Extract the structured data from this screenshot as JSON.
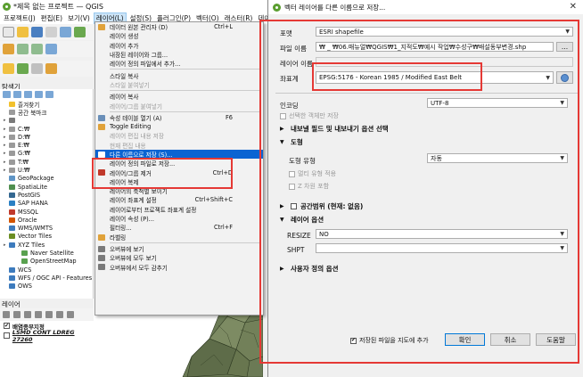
{
  "qgis": {
    "title": "*제목 없는 프로젝트 — QGIS",
    "menus": [
      "프로젝트(J)",
      "편집(E)",
      "보기(V)",
      "레이어(L)",
      "설정(S)",
      "플러그인(P)",
      "벡터(O)",
      "래스터(R)",
      "데이"
    ],
    "browser_title": "탐색기",
    "browser_items": [
      {
        "label": "즐겨찾기",
        "icon": "star-icon",
        "color": "#f2c12e"
      },
      {
        "label": "공간 북마크",
        "icon": "bookmark-icon",
        "color": "#9b9b9b"
      },
      {
        "label": "",
        "icon": "home-icon",
        "color": "#7a7a7a"
      },
      {
        "label": "C:₩",
        "icon": "drive-icon",
        "color": "#9a9a9a"
      },
      {
        "label": "D:₩",
        "icon": "drive-icon",
        "color": "#9a9a9a"
      },
      {
        "label": "E:₩",
        "icon": "drive-icon",
        "color": "#9a9a9a"
      },
      {
        "label": "G:₩",
        "icon": "drive-icon",
        "color": "#9a9a9a"
      },
      {
        "label": "T:₩",
        "icon": "drive-icon",
        "color": "#9a9a9a"
      },
      {
        "label": "U:₩",
        "icon": "drive-icon",
        "color": "#9a9a9a"
      },
      {
        "label": "GeoPackage",
        "icon": "geopackage-icon",
        "color": "#5f95c6"
      },
      {
        "label": "SpatiaLite",
        "icon": "spatialite-icon",
        "color": "#4f8f4f"
      },
      {
        "label": "PostGIS",
        "icon": "postgis-icon",
        "color": "#336791"
      },
      {
        "label": "SAP HANA",
        "icon": "sap-hana-icon",
        "color": "#2a80c4"
      },
      {
        "label": "MSSQL",
        "icon": "mssql-icon",
        "color": "#c0392b"
      },
      {
        "label": "Oracle",
        "icon": "oracle-icon",
        "color": "#d35400"
      },
      {
        "label": "WMS/WMTS",
        "icon": "wms-icon",
        "color": "#3d7bbd"
      },
      {
        "label": "Vector Tiles",
        "icon": "vector-tiles-icon",
        "color": "#6b8e23"
      },
      {
        "label": "XYZ Tiles",
        "icon": "xyz-tiles-icon",
        "color": "#3d7bbd"
      },
      {
        "label": "Naver Satellite",
        "icon": "tile-layer-icon",
        "color": "#59a14f"
      },
      {
        "label": "OpenStreetMap",
        "icon": "tile-layer-icon",
        "color": "#59a14f"
      },
      {
        "label": "WCS",
        "icon": "wcs-icon",
        "color": "#3d7bbd"
      },
      {
        "label": "WFS / OGC API - Features",
        "icon": "wfs-icon",
        "color": "#3d7bbd"
      },
      {
        "label": "OWS",
        "icon": "ows-icon",
        "color": "#3d7bbd"
      }
    ],
    "layers_title": "레이어",
    "layers": [
      {
        "label": "배염종부지정",
        "checked": true
      },
      {
        "label": "LSMD CONT LDREG 27260",
        "checked": false
      }
    ]
  },
  "context_menu": [
    {
      "label": "데이터 원본 관리자 (D)",
      "shortcut": "Ctrl+L",
      "icon": "data-source-icon",
      "color": "#e0a23a"
    },
    {
      "label": "레이어 생성",
      "icon": "",
      "color": ""
    },
    {
      "label": "레이어 추가",
      "icon": "",
      "color": ""
    },
    {
      "label": "내장된 레이어와 그룹...",
      "icon": "",
      "color": ""
    },
    {
      "label": "레이어 정의 파일에서 추가...",
      "icon": "",
      "color": ""
    },
    {
      "sep": true
    },
    {
      "label": "스타일 복사",
      "icon": "",
      "color": ""
    },
    {
      "label": "스타일 붙여넣기",
      "disabled": true,
      "icon": "",
      "color": ""
    },
    {
      "sep": true
    },
    {
      "label": "레이어 복사",
      "icon": "",
      "color": ""
    },
    {
      "label": "레이어/그룹 붙여넣기",
      "disabled": true,
      "icon": "",
      "color": ""
    },
    {
      "sep": true
    },
    {
      "label": "속성 테이블 열기 (A)",
      "shortcut": "F6",
      "icon": "table-icon",
      "color": "#6a8fb9"
    },
    {
      "label": "Toggle Editing",
      "icon": "pencil-icon",
      "color": "#e0a23a"
    },
    {
      "label": "레이어 편집 내용 저장",
      "disabled": true,
      "icon": "",
      "color": ""
    },
    {
      "label": "현재 편집 내용",
      "disabled": true,
      "icon": "",
      "color": ""
    },
    {
      "label": "다른 이름으로 저장 (S)...",
      "highlight": true,
      "icon": "save-as-icon",
      "color": "#ffffff"
    },
    {
      "label": "레이어 정의 파일로 저장...",
      "icon": "",
      "color": ""
    },
    {
      "label": "레이어/그룹 제거",
      "shortcut": "Ctrl+D",
      "icon": "remove-layer-icon",
      "color": "#c0392b"
    },
    {
      "label": "레이어 복제",
      "icon": "",
      "color": ""
    },
    {
      "label": "레이어의 축척별 보이기",
      "icon": "",
      "color": ""
    },
    {
      "label": "레이어 좌표계 설정",
      "shortcut": "Ctrl+Shift+C",
      "icon": "",
      "color": ""
    },
    {
      "label": "레이어로부터 프로젝트 좌표계 설정",
      "icon": "",
      "color": ""
    },
    {
      "label": "레이어 속성 (P)...",
      "icon": "",
      "color": ""
    },
    {
      "label": "필터링...",
      "shortcut": "Ctrl+F",
      "icon": "",
      "color": ""
    },
    {
      "label": "라벨링",
      "icon": "label-icon",
      "color": "#e0a23a"
    },
    {
      "sep": true
    },
    {
      "label": "오버뷰에 보기",
      "icon": "overview-icon",
      "color": "#7a7a7a"
    },
    {
      "label": "오버뷰에 모두 보기",
      "icon": "overview-icon",
      "color": "#7a7a7a"
    },
    {
      "label": "오버뷰에서 모두 감추기",
      "icon": "overview-icon",
      "color": "#7a7a7a"
    }
  ],
  "dialog": {
    "title": "벡터 레이어를 다른 이름으로 저장...",
    "format_label": "포맷",
    "format_value": "ESRI shapefile",
    "filename_label": "파일 이름",
    "filename_value": "₩ _ ₩06.매뉴얼₩QGIS₩1_지적도₩예시 작업₩수성구₩배설동부변경.shp",
    "browse_label": "...",
    "layername_label": "레이어 이름",
    "crs_label": "좌표계",
    "crs_value": "EPSG:5176 - Korean 1985 / Modified East Belt",
    "encoding_label": "인코딩",
    "encoding_value": "UTF-8",
    "selected_only_label": "선택한 객체만 저장",
    "export_fields_label": "내보낼 필드 및 내보내기 옵션 선택",
    "geometry_section": "도형",
    "geometry_type_label": "도형 유형",
    "geometry_type_value": "자동",
    "multi_label": "멀티 유형 적용",
    "z_label": "Z 차원 포함",
    "extent_section": "공간범위 (현재: 없음)",
    "layer_options_section": "레이어 옵션",
    "resize_label": "RESIZE",
    "resize_value": "NO",
    "shpt_label": "SHPT",
    "shpt_value": "",
    "custom_options_section": "사용자 정의 옵션",
    "add_to_map_label": "저장된 파일을 지도에 추가",
    "ok_label": "확인",
    "cancel_label": "취소",
    "help_label": "도움말",
    "close_glyph": "✕"
  },
  "colors": {
    "highlight": "#0a64d2",
    "annotation_red": "#e53935",
    "qgis_green": "#5a9e2f"
  }
}
